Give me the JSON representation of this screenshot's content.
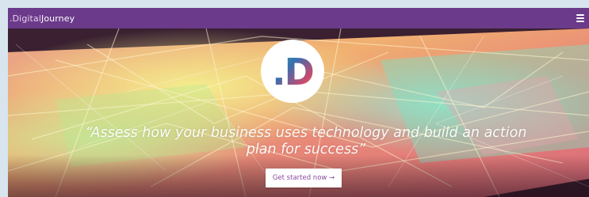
{
  "navbar": {
    "brand_light": ".Digital",
    "brand_bold": "Journey",
    "menu_icon": "hamburger-menu-icon",
    "bg_color": "#6b3a8a"
  },
  "hero": {
    "logo_mark": ".D",
    "quote": "“Assess how your business uses technology and build an action plan for success”",
    "cta_label": "Get started now →"
  },
  "colors": {
    "brand_purple": "#6b3a8a",
    "cta_text": "#8a4a9c",
    "page_bg": "#d8e4ee"
  }
}
